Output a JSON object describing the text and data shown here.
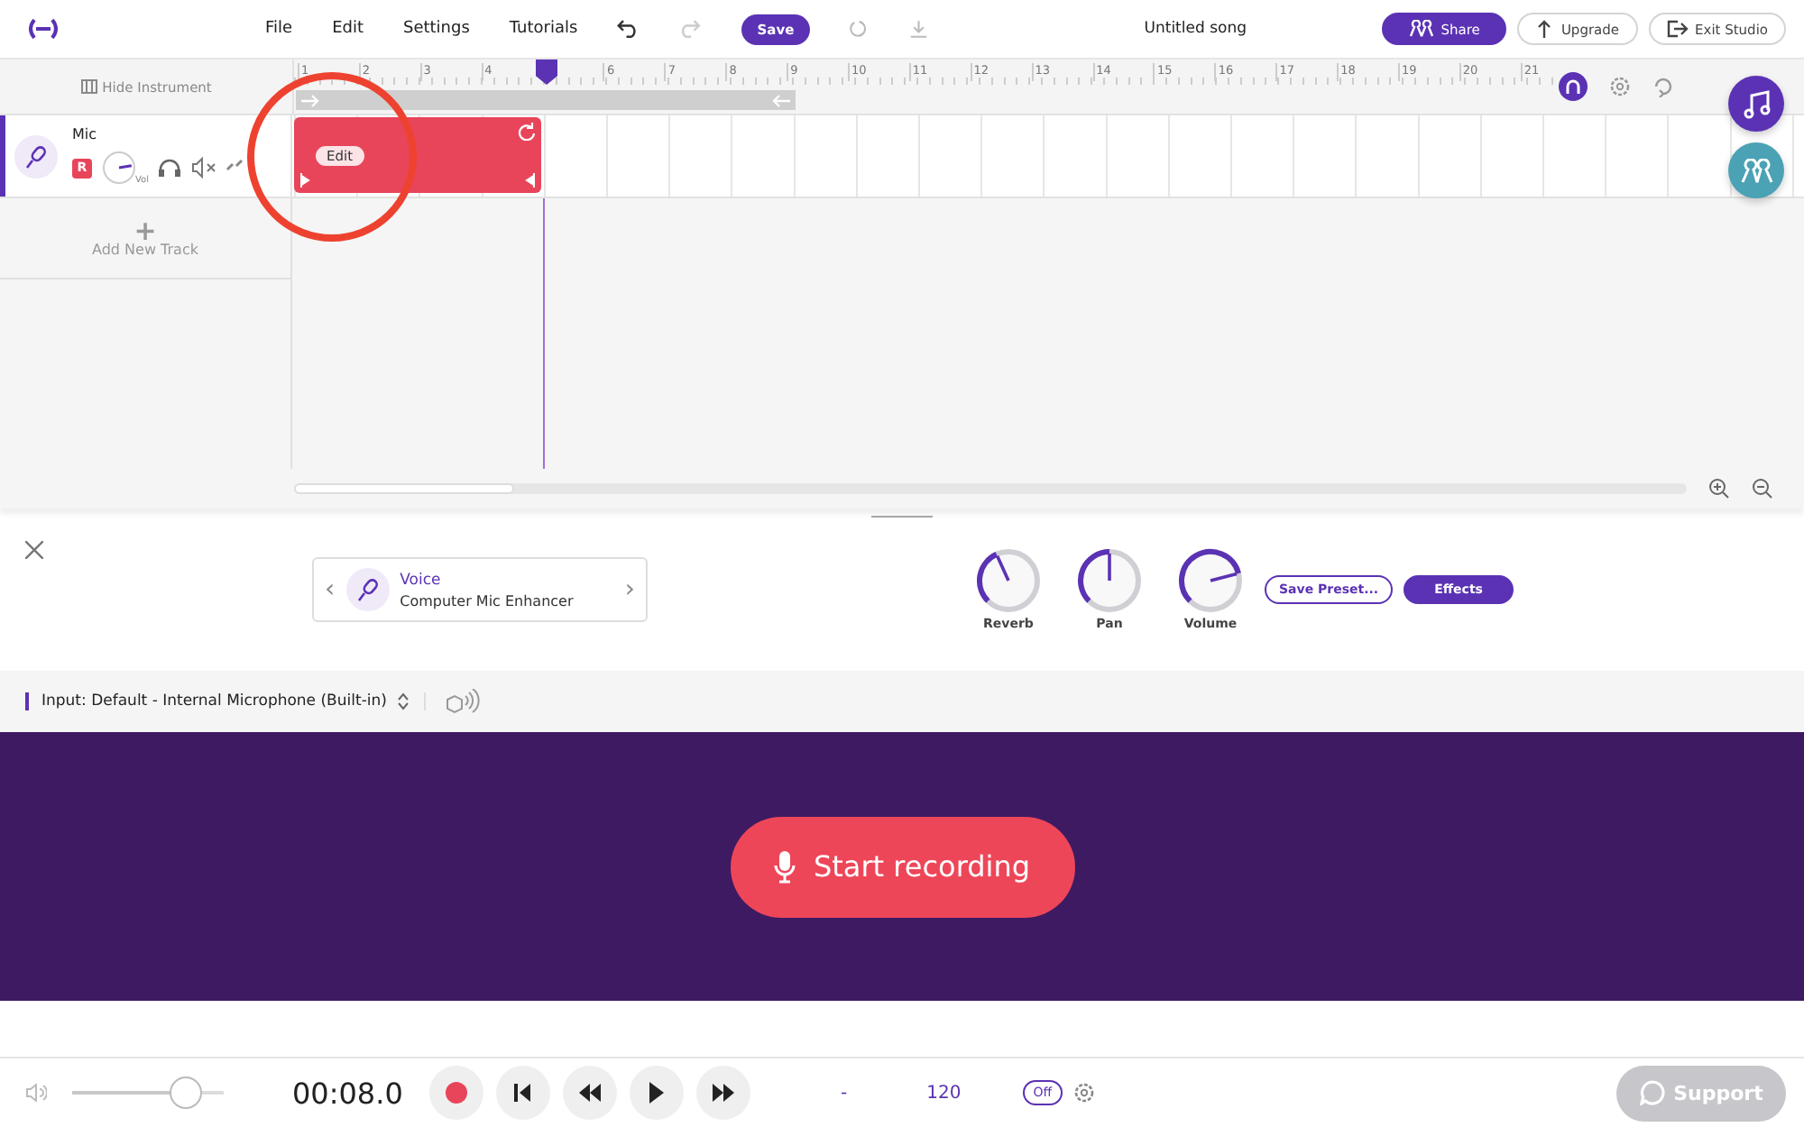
{
  "menu": [
    "File",
    "Edit",
    "Settings",
    "Tutorials"
  ],
  "save_button": "Save",
  "song_title": "Untitled song",
  "header_buttons": [
    {
      "label": "Share",
      "kind": "primary"
    },
    {
      "label": "Upgrade",
      "kind": "upload"
    },
    {
      "label": "Exit Studio",
      "kind": "exit"
    }
  ],
  "hide_instrument": "Hide Instrument",
  "ruler_before_playhead": [
    "1",
    "2",
    "3",
    "4"
  ],
  "ruler_after_playhead": [
    "6",
    "7",
    "8",
    "9",
    "10",
    "11",
    "12",
    "13",
    "14",
    "15",
    "16",
    "17",
    "18",
    "19",
    "20",
    "21"
  ],
  "tracks": [
    {
      "name": "Mic",
      "record_armed": true,
      "record_label": "R",
      "volume_label": "Vol",
      "selected": true,
      "region_label": "Edit"
    }
  ],
  "add_track": {
    "icon": "+",
    "label": "Add New Track"
  },
  "instrument": {
    "prev": "‹",
    "category": "Voice",
    "preset": "Computer Mic Enhancer",
    "next": "›"
  },
  "knobs": [
    {
      "label": "Reverb"
    },
    {
      "label": "Pan"
    },
    {
      "label": "Volume"
    }
  ],
  "save_preset": "Save Preset...",
  "effects": "Effects",
  "input": "Input: Default - Internal Microphone (Built-in)",
  "start_recording": "Start recording",
  "transport": {
    "time": "00:08.0",
    "key": "-",
    "tempo": "120",
    "metronome": {
      "label": "Off",
      "on": false
    }
  },
  "support": "Support"
}
